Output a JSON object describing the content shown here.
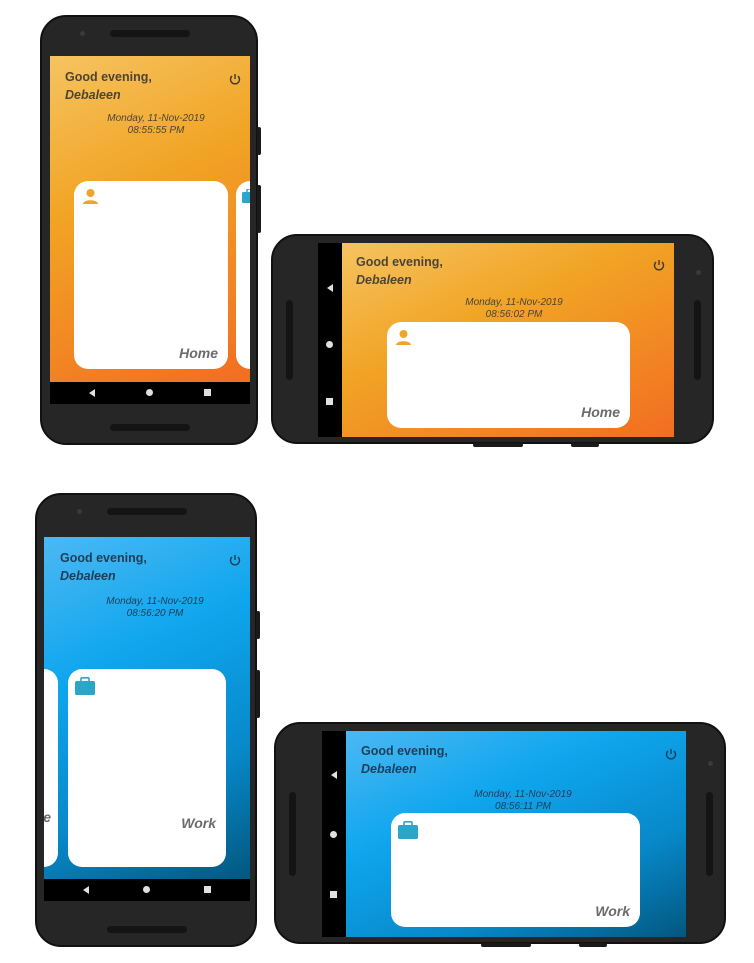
{
  "app": {
    "greeting": "Good evening,",
    "user_name": "Debaleen"
  },
  "screens": {
    "home_portrait": {
      "date": "Monday, 11-Nov-2019",
      "time": "08:55:55 PM",
      "card_label": "Home"
    },
    "home_landscape": {
      "date": "Monday, 11-Nov-2019",
      "time": "08:56:02 PM",
      "card_label": "Home"
    },
    "work_portrait": {
      "date": "Monday, 11-Nov-2019",
      "time": "08:56:20 PM",
      "card_label": "Work",
      "partial_card_label": "e"
    },
    "work_landscape": {
      "date": "Monday, 11-Nov-2019",
      "time": "08:56:11 PM",
      "card_label": "Work"
    }
  },
  "icons": {
    "power": "power-icon",
    "home": "person-icon",
    "work": "briefcase-icon"
  },
  "colors": {
    "orange_start": "#f6c361",
    "orange_end": "#f26d22",
    "blue_start": "#4cb8f3",
    "blue_end": "#03577f",
    "home_icon": "#f0a52a",
    "work_icon": "#2ba6c8"
  }
}
